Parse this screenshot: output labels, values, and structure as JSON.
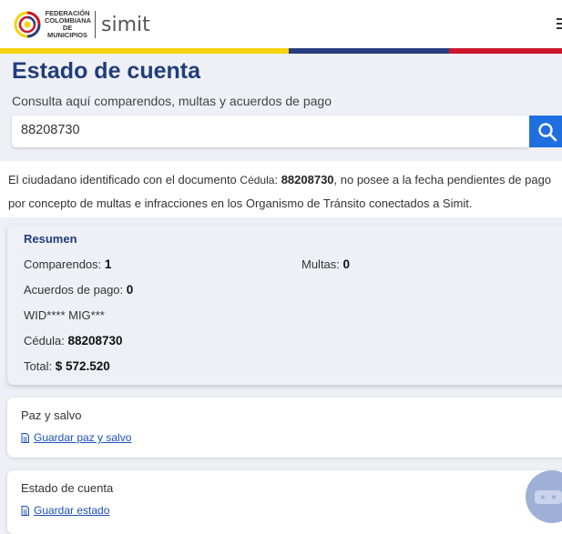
{
  "header": {
    "logo_lines": [
      "FEDERACIÓN",
      "COLOMBIANA",
      "DE MUNICIPIOS"
    ],
    "brand": "simit",
    "menu_icon": "hamburger-menu-icon",
    "flag_colors": [
      "#f7d20d",
      "#283e80",
      "#c9162c"
    ]
  },
  "page": {
    "title": "Estado de cuenta",
    "subtitle": "Consulta aquí comparendos, multas y acuerdos de pago"
  },
  "search": {
    "value": "88208730",
    "button_icon": "search-icon",
    "accent": "#1f6fe0"
  },
  "message": {
    "part1": "El ciudadano identificado con el documento ",
    "doc_type": "Cédula",
    "colon": ":",
    "doc_number": "88208730",
    "part2": ", no posee a la fecha pendientes de pago por concepto de multas e infracciones en los Organismo de Tránsito conectados a Simit."
  },
  "summary": {
    "title": "Resumen",
    "comparendos_label": "Comparendos:",
    "comparendos_value": "1",
    "multas_label": "Multas:",
    "multas_value": "0",
    "acuerdos_label": "Acuerdos de pago:",
    "acuerdos_value": "0",
    "name": "WID**** MIG***",
    "cedula_label": "Cédula:",
    "cedula_value": "88208730",
    "total_label": "Total:",
    "total_value": "$ 572.520"
  },
  "cards": [
    {
      "title": "Paz y salvo",
      "link": "Guardar paz y salvo",
      "icon": "document-icon"
    },
    {
      "title": "Estado de cuenta",
      "link": "Guardar estado",
      "icon": "document-icon"
    }
  ],
  "chat": {
    "icon": "chatbot-icon"
  }
}
